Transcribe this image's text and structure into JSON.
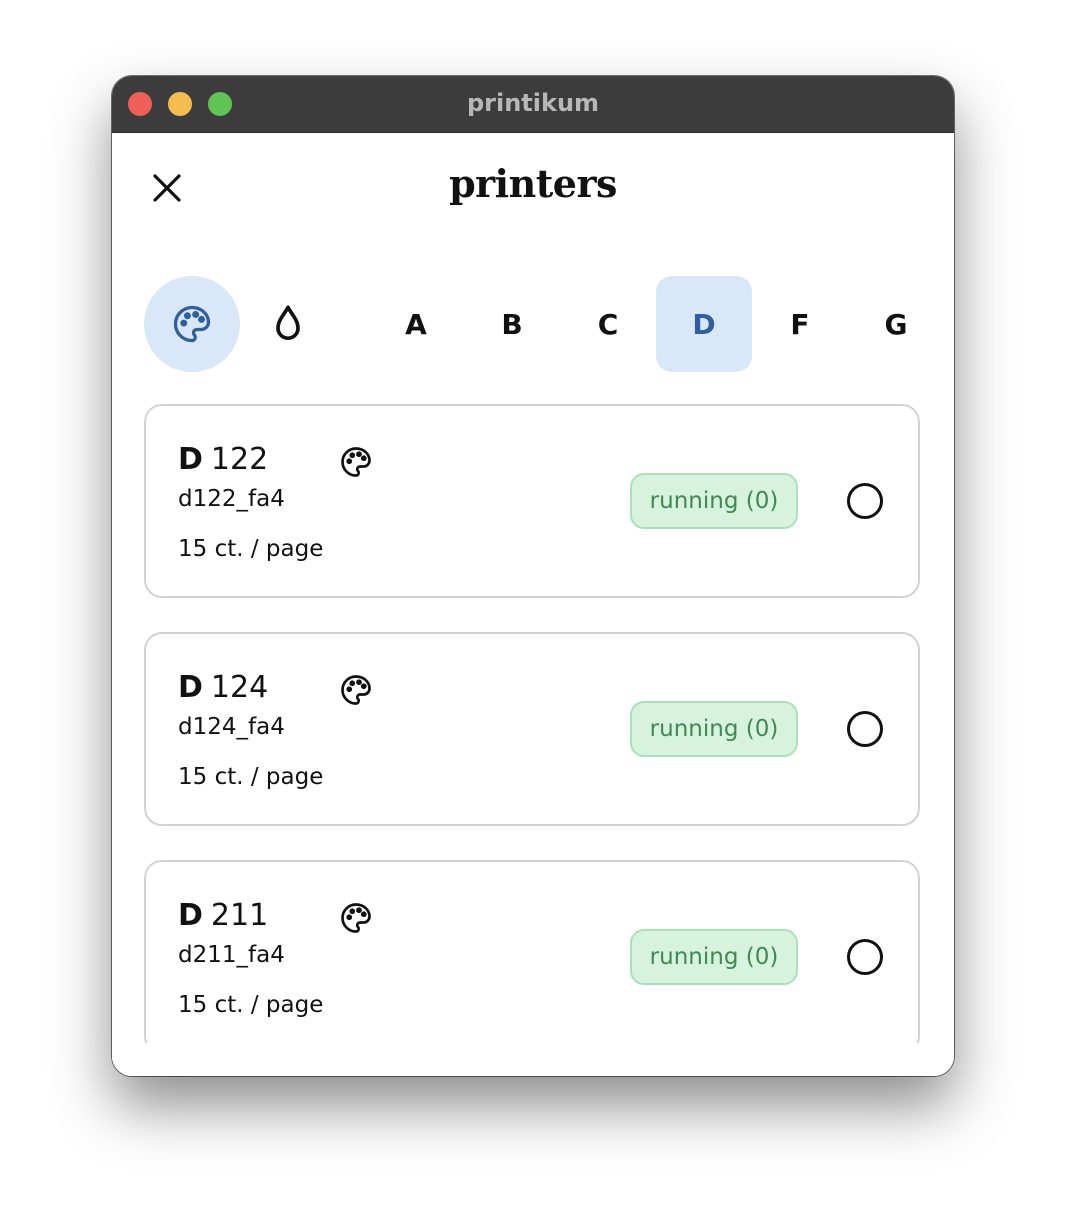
{
  "window": {
    "title": "printikum"
  },
  "header": {
    "title": "printers",
    "close_icon": "close-icon"
  },
  "filters": {
    "icons": [
      {
        "icon": "palette-icon",
        "selected": true
      },
      {
        "icon": "droplet-icon",
        "selected": false
      }
    ],
    "buildings": [
      {
        "label": "A",
        "selected": false
      },
      {
        "label": "B",
        "selected": false
      },
      {
        "label": "C",
        "selected": false
      },
      {
        "label": "D",
        "selected": true
      },
      {
        "label": "F",
        "selected": false
      },
      {
        "label": "G",
        "selected": false
      }
    ]
  },
  "printers": [
    {
      "building": "D",
      "room": "122",
      "queue": "d122_fa4",
      "price": "15 ct. / page",
      "status": "running (0)",
      "color": true
    },
    {
      "building": "D",
      "room": "124",
      "queue": "d124_fa4",
      "price": "15 ct. / page",
      "status": "running (0)",
      "color": true
    },
    {
      "building": "D",
      "room": "211",
      "queue": "d211_fa4",
      "price": "15 ct. / page",
      "status": "running (0)",
      "color": true
    }
  ],
  "colors": {
    "accent_bg": "#d9e8f9",
    "accent_text": "#2f5f9e",
    "status_bg": "#d7f3de",
    "status_border": "#a9e2b9",
    "status_text": "#3f8a52"
  }
}
